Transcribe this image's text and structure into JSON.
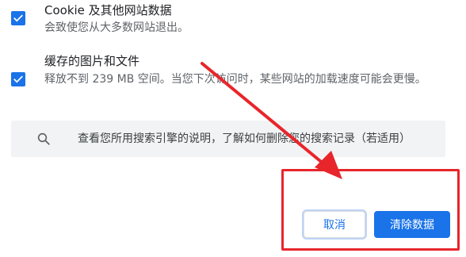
{
  "options": [
    {
      "title": "Cookie 及其他网站数据",
      "description": "会致使您从大多数网站退出。",
      "checked": true
    },
    {
      "title": "缓存的图片和文件",
      "description": "释放不到 239 MB 空间。当您下次访问时，某些网站的加载速度可能会更慢。",
      "checked": true
    }
  ],
  "search_card": {
    "text": "查看您所用搜索引擎的说明，了解如何删除您的搜索记录（若适用）",
    "icon": "search-icon"
  },
  "buttons": {
    "cancel_label": "取消",
    "clear_label": "清除数据"
  },
  "colors": {
    "accent": "#1a73e8",
    "annotation": "#e8252b"
  }
}
